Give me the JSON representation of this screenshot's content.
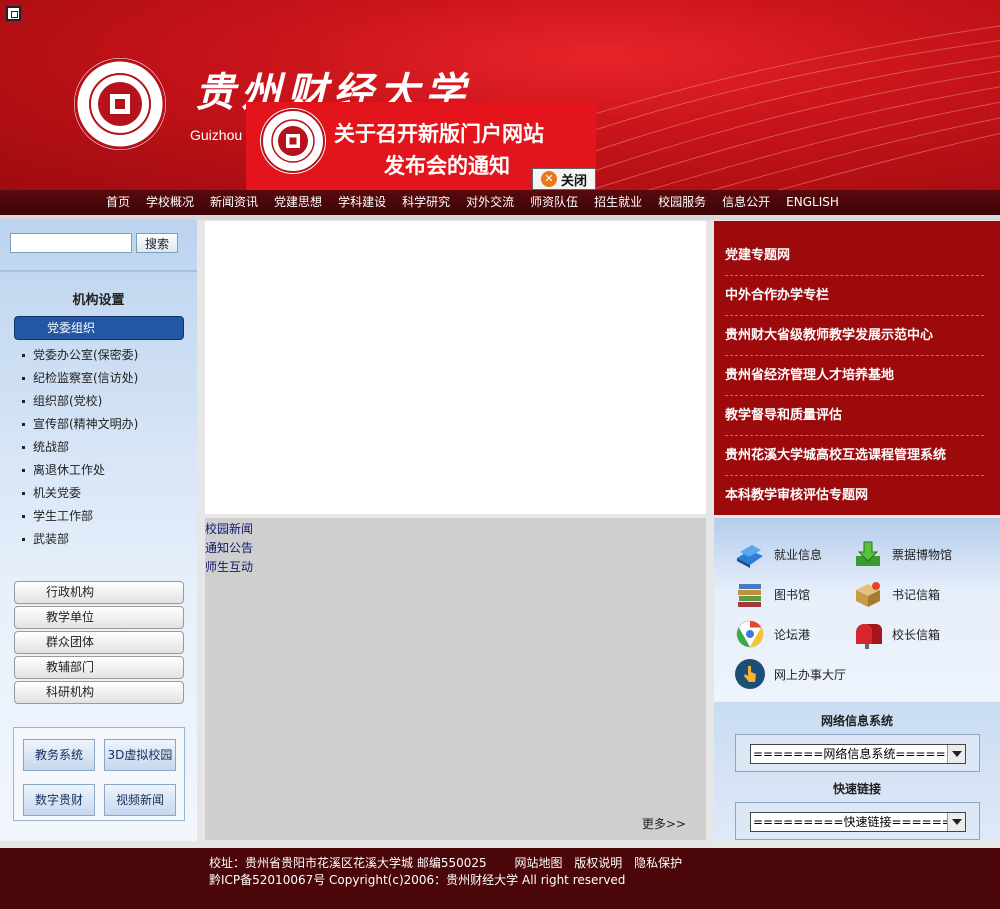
{
  "header": {
    "site_name": "贵州财经大学",
    "site_name_en": "Guizhou U",
    "colors": {
      "brand_red": "#c8141a",
      "nav_dark": "#4a0608",
      "accent_blue": "#2357a4"
    }
  },
  "popup": {
    "line1": "关于召开新版门户网站",
    "line2": "发布会的通知",
    "close_label": "关闭",
    "close_icon": "close-circle-icon"
  },
  "nav": {
    "items": [
      "首页",
      "学校概况",
      "新闻资讯",
      "党建思想",
      "学科建设",
      "科学研究",
      "对外交流",
      "师资队伍",
      "招生就业",
      "校园服务",
      "信息公开",
      "ENGLISH"
    ]
  },
  "search": {
    "button_label": "搜索",
    "value": ""
  },
  "org": {
    "title": "机构设置",
    "active": "党委组织",
    "items": [
      "党委办公室(保密委)",
      "纪检监察室(信访处)",
      "组织部(党校)",
      "宣传部(精神文明办)",
      "统战部",
      "离退休工作处",
      "机关党委",
      "学生工作部",
      "武装部"
    ],
    "groups": [
      "行政机构",
      "教学单位",
      "群众团体",
      "教辅部门",
      "科研机构"
    ]
  },
  "systems": {
    "buttons": [
      "教务系统",
      "3D虚拟校园",
      "数字贵财",
      "视频新闻"
    ]
  },
  "news": {
    "tabs": [
      "校园新闻",
      "通知公告",
      "师生互动"
    ],
    "more": "更多>>"
  },
  "right_links": [
    "党建专题网",
    "中外合作办学专栏",
    "贵州财大省级教师教学发展示范中心",
    "贵州省经济管理人才培养基地",
    "教学督导和质量评估",
    "贵州花溪大学城高校互选课程管理系统",
    "本科教学审核评估专题网"
  ],
  "services": [
    {
      "label": "就业信息",
      "icon": "book-icon"
    },
    {
      "label": "票据博物馆",
      "icon": "download-icon"
    },
    {
      "label": "图书馆",
      "icon": "books-icon"
    },
    {
      "label": "书记信箱",
      "icon": "package-icon"
    },
    {
      "label": "论坛港",
      "icon": "chrome-icon"
    },
    {
      "label": "校长信箱",
      "icon": "mailbox-icon"
    },
    {
      "label": "网上办事大厅",
      "icon": "hand-pointer-icon"
    }
  ],
  "network_system": {
    "title": "网络信息系统",
    "selected": "=======网络信息系统======="
  },
  "quick_links": {
    "title": "快速链接",
    "selected": "=========快速链接========="
  },
  "footer": {
    "address": "校址：贵州省贵阳市花溪区花溪大学城 邮编550025",
    "links": [
      "网站地图",
      "版权说明",
      "隐私保护"
    ],
    "copyright": "黔ICP备52010067号 Copyright(c)2006：贵州财经大学 All right reserved"
  }
}
